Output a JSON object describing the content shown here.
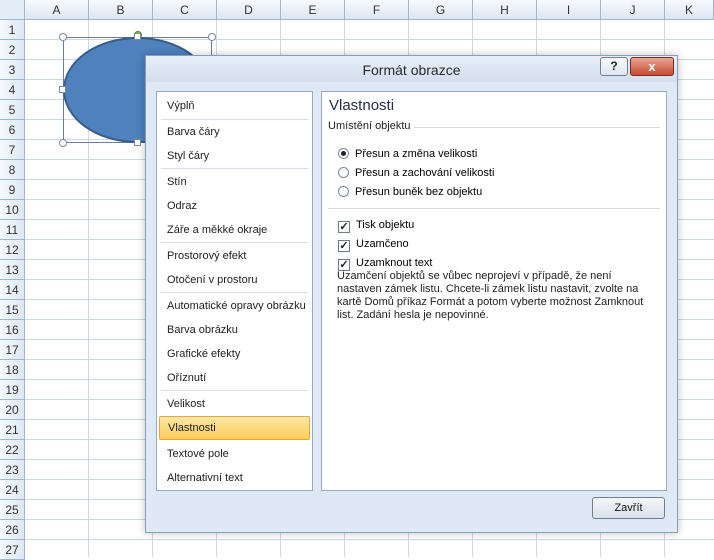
{
  "sheet": {
    "columns": [
      "A",
      "B",
      "C",
      "D",
      "E",
      "F",
      "G",
      "H",
      "I",
      "J",
      "K"
    ],
    "rows": [
      "1",
      "2",
      "3",
      "4",
      "5",
      "6",
      "7",
      "8",
      "9",
      "10",
      "11",
      "12",
      "13",
      "14",
      "15",
      "16",
      "17",
      "18",
      "19",
      "20",
      "21",
      "22",
      "23",
      "24",
      "25",
      "26",
      "27"
    ]
  },
  "dialog": {
    "title": "Formát obrazce",
    "help_label": "?",
    "close_label": "x",
    "nav": {
      "items": [
        {
          "label": "Výplň"
        },
        {
          "label": "Barva čáry"
        },
        {
          "label": "Styl čáry"
        },
        {
          "label": "Stín"
        },
        {
          "label": "Odraz"
        },
        {
          "label": "Záře a měkké okraje"
        },
        {
          "label": "Prostorový efekt"
        },
        {
          "label": "Otočení v prostoru"
        },
        {
          "label": "Automatické opravy obrázku"
        },
        {
          "label": "Barva obrázku"
        },
        {
          "label": "Grafické efekty"
        },
        {
          "label": "Oříznutí"
        },
        {
          "label": "Velikost"
        },
        {
          "label": "Vlastnosti"
        },
        {
          "label": "Textové pole"
        },
        {
          "label": "Alternativní text"
        }
      ],
      "selected": "Vlastnosti"
    },
    "content": {
      "title": "Vlastnosti",
      "section_label": "Umístění objektu",
      "radios": [
        {
          "label": "Přesun a změna velikosti",
          "checked": true
        },
        {
          "label": "Přesun a zachování velikosti",
          "checked": false
        },
        {
          "label": "Přesun buněk bez objektu",
          "checked": false
        }
      ],
      "checks": [
        {
          "label": "Tisk objektu",
          "checked": true
        },
        {
          "label": "Uzamčeno",
          "checked": true
        },
        {
          "label": "Uzamknout text",
          "checked": true
        }
      ],
      "description": "Uzamčení objektů se vůbec neprojeví v případě, že není nastaven zámek listu. Chcete-li zámek listu nastavit, zvolte na kartě Domů příkaz Formát a potom vyberte možnost Zamknout list. Zadání hesla je nepovinné."
    },
    "close_button_label": "Zavřít"
  },
  "colors": {
    "shape_fill": "#4f81bd",
    "shape_border": "#385d8a",
    "selected_nav": "#fbcd58",
    "close_button": "#c74a32"
  }
}
